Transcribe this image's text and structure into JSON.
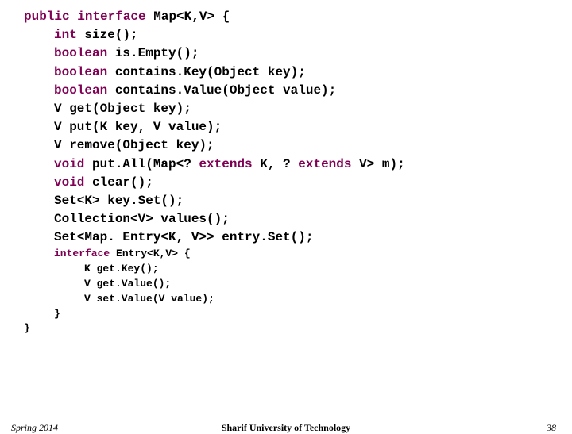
{
  "code": {
    "l1a": "public interface ",
    "l1b": "Map<K,V> {",
    "l2a": "int ",
    "l2b": "size();",
    "l3a": "boolean ",
    "l3b": "is.Empty();",
    "l4a": "boolean ",
    "l4b": "contains.Key(Object key);",
    "l5a": "boolean ",
    "l5b": "contains.Value(Object value);",
    "l6": "V get(Object key);",
    "l7": "V put(K key, V value);",
    "l8": "V remove(Object key);",
    "l9a": "void ",
    "l9b": "put.All(Map<? ",
    "l9c": "extends ",
    "l9d": "K, ? ",
    "l9e": "extends ",
    "l9f": "V> m);",
    "l10a": "void ",
    "l10b": "clear();",
    "l11": "Set<K> key.Set();",
    "l12": "Collection<V> values();",
    "l13": "Set<Map. Entry<K, V>> entry.Set();",
    "l14a": "interface ",
    "l14b": "Entry<K,V> {",
    "l15": "K get.Key();",
    "l16": "V get.Value();",
    "l17": "V set.Value(V value);",
    "l18": "}",
    "l19": "}"
  },
  "footer": {
    "left": "Spring 2014",
    "center": "Sharif University of Technology",
    "right": "38"
  }
}
